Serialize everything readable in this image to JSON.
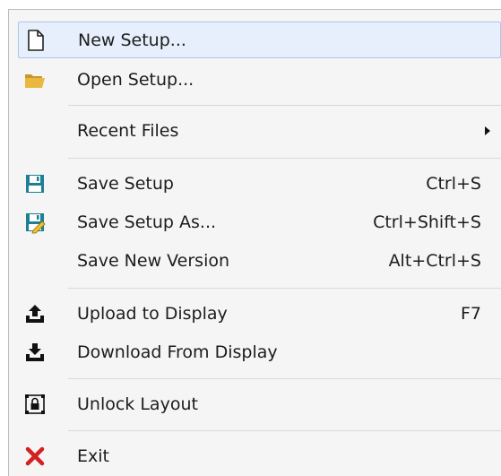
{
  "menu": {
    "items": [
      {
        "label": "New Setup...",
        "icon": "new-document-icon",
        "shortcut": ""
      },
      {
        "label": "Open Setup...",
        "icon": "folder-open-icon",
        "shortcut": ""
      },
      {
        "label": "Recent Files",
        "icon": "",
        "shortcut": "",
        "submenu": true
      },
      {
        "label": "Save Setup",
        "icon": "save-icon",
        "shortcut": "Ctrl+S"
      },
      {
        "label": "Save Setup As...",
        "icon": "save-as-icon",
        "shortcut": "Ctrl+Shift+S"
      },
      {
        "label": "Save New Version",
        "icon": "",
        "shortcut": "Alt+Ctrl+S"
      },
      {
        "label": "Upload to Display",
        "icon": "upload-icon",
        "shortcut": "F7"
      },
      {
        "label": "Download From Display",
        "icon": "download-icon",
        "shortcut": ""
      },
      {
        "label": "Unlock Layout",
        "icon": "unlock-layout-icon",
        "shortcut": ""
      },
      {
        "label": "Exit",
        "icon": "exit-icon",
        "shortcut": ""
      }
    ]
  },
  "colors": {
    "highlight": "#e6effb",
    "highlight_border": "#a9c6ee",
    "save_teal": "#1d7f92",
    "folder_yellow": "#e8b43a",
    "exit_red": "#d42020"
  }
}
